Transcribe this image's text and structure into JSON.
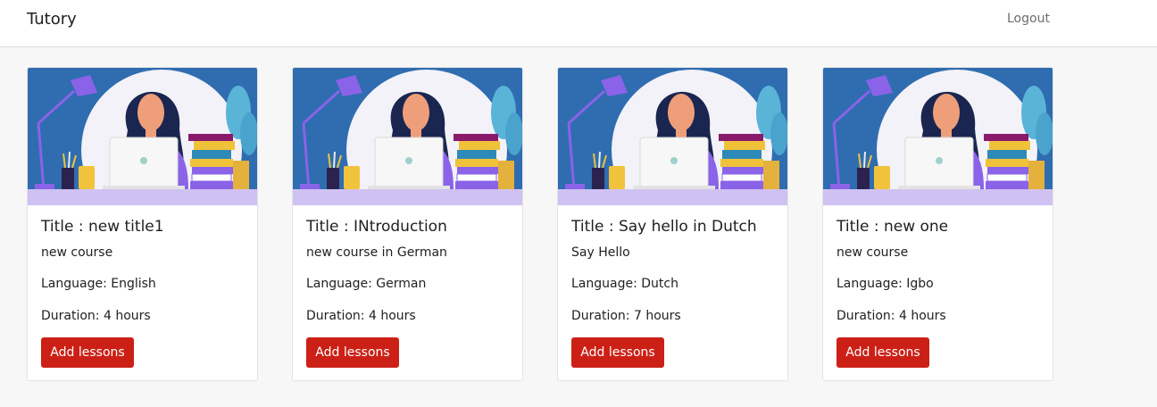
{
  "navbar": {
    "brand": "Tutory",
    "logout_label": "Logout"
  },
  "courses": [
    {
      "title": "Title : new title1",
      "description": "new course",
      "language": "Language: English",
      "duration": "Duration: 4 hours",
      "button_label": "Add lessons"
    },
    {
      "title": "Title : INtroduction",
      "description": "new course in German",
      "language": "Language: German",
      "duration": "Duration: 4 hours",
      "button_label": "Add lessons"
    },
    {
      "title": "Title : Say hello in Dutch",
      "description": "Say Hello",
      "language": "Language: Dutch",
      "duration": "Duration: 7 hours",
      "button_label": "Add lessons"
    },
    {
      "title": "Title : new one",
      "description": "new course",
      "language": "Language: Igbo",
      "duration": "Duration: 4 hours",
      "button_label": "Add lessons"
    }
  ],
  "colors": {
    "button": "#cc2016",
    "image_background": "#2f6db0",
    "accent_purple": "#8a63e8"
  },
  "icons": {
    "card_image": "woman-at-laptop-illustration"
  }
}
